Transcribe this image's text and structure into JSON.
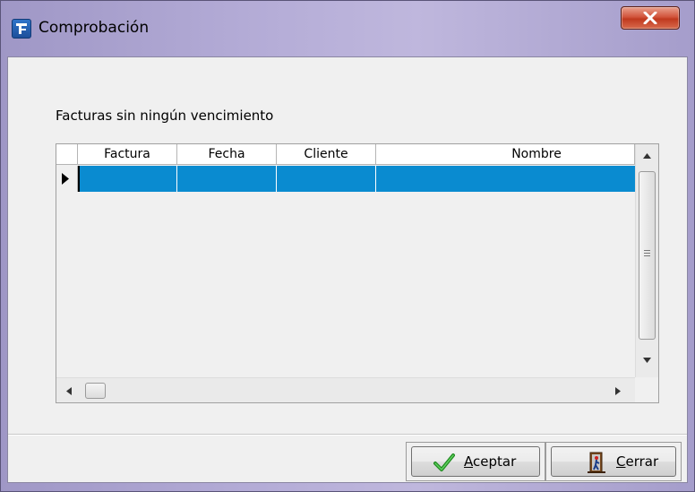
{
  "window": {
    "title": "Comprobación"
  },
  "content": {
    "section_label": "Facturas sin ningún vencimiento"
  },
  "grid": {
    "columns": [
      "Factura",
      "Fecha",
      "Cliente",
      "Nombre"
    ],
    "rows": [
      [
        "",
        "",
        "",
        ""
      ]
    ],
    "selected_row_color": "#0a8bd0"
  },
  "buttons": {
    "accept": {
      "accel": "A",
      "rest": "ceptar"
    },
    "close": {
      "accel": "C",
      "rest": "errar"
    }
  },
  "icons": {
    "app": "app-f-icon",
    "window_close": "close-x-icon",
    "accept": "green-checkmark-icon",
    "close": "door-exit-icon"
  }
}
